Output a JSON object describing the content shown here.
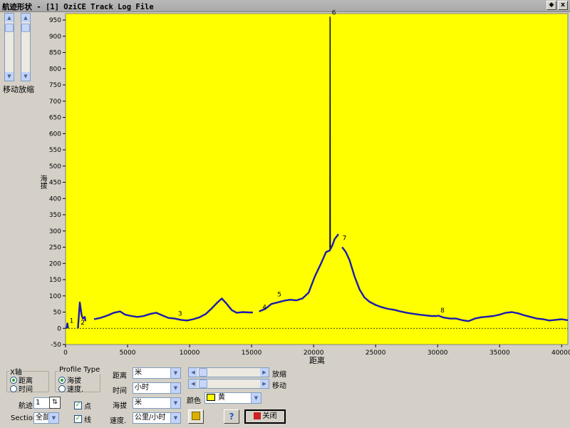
{
  "window": {
    "title": "航迹形状 - [1] OziCE Track Log File",
    "minimize_glyph": "◆",
    "close_glyph": "x"
  },
  "side": {
    "move_label": "移动",
    "zoom_label": "放缩"
  },
  "colors": {
    "plot_bg": "#ffff00",
    "track_line": "#1a1ab0",
    "spike_line": "#000000"
  },
  "chart_data": {
    "type": "line",
    "title": "",
    "xlabel": "距离",
    "ylabel": "海拔",
    "xlim": [
      0,
      40500
    ],
    "ylim": [
      -50,
      970
    ],
    "x_ticks": [
      0,
      5000,
      10000,
      15000,
      20000,
      25000,
      30000,
      35000,
      40000
    ],
    "y_ticks": [
      -50,
      0,
      50,
      100,
      150,
      200,
      250,
      300,
      350,
      400,
      450,
      500,
      550,
      600,
      650,
      700,
      750,
      800,
      850,
      900,
      950
    ],
    "grid": false,
    "reference_line_y": 0,
    "segments": [
      {
        "name": "1",
        "points": [
          [
            80,
            0
          ],
          [
            150,
            15
          ],
          [
            200,
            0
          ]
        ]
      },
      {
        "name": "2",
        "points": [
          [
            1000,
            0
          ],
          [
            1150,
            80
          ],
          [
            1300,
            40
          ],
          [
            1400,
            30
          ],
          [
            1550,
            35
          ],
          [
            1600,
            22
          ]
        ]
      },
      {
        "name": "3",
        "points": [
          [
            2300,
            28
          ],
          [
            2800,
            32
          ],
          [
            3400,
            40
          ],
          [
            3900,
            48
          ],
          [
            4400,
            52
          ],
          [
            4800,
            42
          ],
          [
            5300,
            38
          ],
          [
            5800,
            35
          ],
          [
            6300,
            38
          ],
          [
            6800,
            44
          ],
          [
            7300,
            48
          ],
          [
            7800,
            40
          ],
          [
            8300,
            32
          ],
          [
            8800,
            30
          ],
          [
            9300,
            26
          ],
          [
            9800,
            24
          ],
          [
            10300,
            28
          ],
          [
            10800,
            34
          ],
          [
            11300,
            44
          ],
          [
            11800,
            62
          ],
          [
            12200,
            78
          ],
          [
            12600,
            92
          ],
          [
            13000,
            75
          ],
          [
            13400,
            56
          ],
          [
            13800,
            48
          ],
          [
            14300,
            50
          ],
          [
            14800,
            49
          ],
          [
            15100,
            49
          ]
        ]
      },
      {
        "name": "4",
        "points": [
          [
            15600,
            52
          ],
          [
            16100,
            60
          ],
          [
            16600,
            75
          ],
          [
            17100,
            80
          ],
          [
            17600,
            85
          ],
          [
            18100,
            88
          ],
          [
            18600,
            86
          ],
          [
            19100,
            92
          ],
          [
            19600,
            110
          ],
          [
            20100,
            160
          ],
          [
            20600,
            200
          ],
          [
            21000,
            235
          ],
          [
            21300,
            240
          ],
          [
            21500,
            255
          ],
          [
            21700,
            275
          ],
          [
            21900,
            285
          ],
          [
            22000,
            290
          ]
        ]
      },
      {
        "name": "5",
        "points": [
          [
            21300,
            245
          ],
          [
            21320,
            960
          ],
          [
            21340,
            955
          ],
          [
            21360,
            250
          ]
        ]
      },
      {
        "name": "7",
        "points": [
          [
            22300,
            250
          ],
          [
            22600,
            235
          ],
          [
            22900,
            210
          ],
          [
            23300,
            160
          ],
          [
            23700,
            120
          ],
          [
            24100,
            95
          ],
          [
            24500,
            82
          ],
          [
            25000,
            72
          ],
          [
            25500,
            65
          ],
          [
            26000,
            60
          ],
          [
            26500,
            57
          ],
          [
            27000,
            52
          ],
          [
            27500,
            48
          ],
          [
            28000,
            45
          ],
          [
            28500,
            42
          ],
          [
            29000,
            40
          ],
          [
            29500,
            38
          ],
          [
            30000,
            38
          ]
        ]
      },
      {
        "name": "8",
        "points": [
          [
            30000,
            40
          ],
          [
            30500,
            33
          ],
          [
            31000,
            30
          ],
          [
            31500,
            30
          ],
          [
            32000,
            25
          ],
          [
            32500,
            22
          ],
          [
            33000,
            30
          ],
          [
            33500,
            34
          ],
          [
            34000,
            36
          ],
          [
            34500,
            38
          ],
          [
            35000,
            42
          ],
          [
            35500,
            48
          ],
          [
            36000,
            50
          ],
          [
            36500,
            46
          ],
          [
            37000,
            40
          ],
          [
            37500,
            35
          ],
          [
            38000,
            30
          ],
          [
            38500,
            28
          ],
          [
            39000,
            24
          ],
          [
            39500,
            26
          ],
          [
            40000,
            28
          ],
          [
            40500,
            25
          ]
        ]
      }
    ],
    "segment_labels": [
      {
        "text": "1",
        "x": 150,
        "y": 10
      },
      {
        "text": "2",
        "x": 1050,
        "y": 5
      },
      {
        "text": "3",
        "x": 8900,
        "y": 32
      },
      {
        "text": "4",
        "x": 15700,
        "y": 52
      },
      {
        "text": "5",
        "x": 16900,
        "y": 92
      },
      {
        "text": "6",
        "x": 21300,
        "y": 960
      },
      {
        "text": "7",
        "x": 22150,
        "y": 265
      },
      {
        "text": "8",
        "x": 30050,
        "y": 42
      }
    ]
  },
  "controls": {
    "x_axis_group": "X轴",
    "x_axis_options": [
      "距离",
      "时间"
    ],
    "x_axis_selected": 0,
    "profile_group": "Profile Type",
    "profile_options": [
      "海拔",
      "速度."
    ],
    "profile_selected": 0,
    "track_label": "航迹",
    "track_value": "1",
    "section_label": "Section",
    "section_value": "全部",
    "points_label": "点",
    "lines_label": "线",
    "distance_label": "距离",
    "distance_unit": "米",
    "time_label": "时间",
    "time_unit": "小时",
    "altitude_label": "海拔",
    "altitude_unit": "米",
    "speed_label": "速度.",
    "speed_unit": "公里/小时",
    "hzoom_label": "放缩",
    "hmove_label": "移动",
    "color_label": "颜色",
    "color_value": "黄",
    "help_glyph": "?",
    "close_label": "关闭"
  }
}
